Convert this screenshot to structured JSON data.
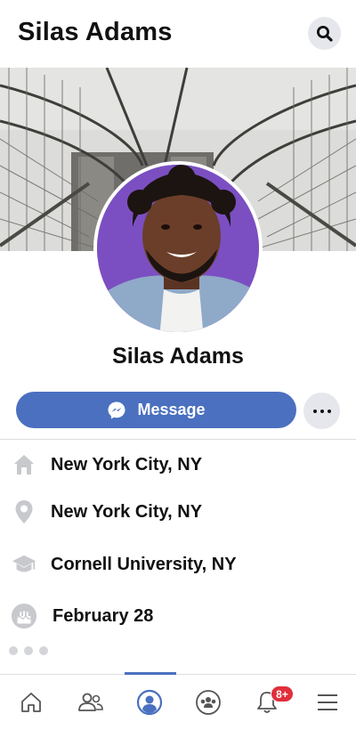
{
  "header": {
    "title": "Silas Adams",
    "search_icon": "search-icon"
  },
  "profile": {
    "name": "Silas Adams",
    "message_label": "Message",
    "message_icon": "messenger-icon",
    "more_icon": "more-horizontal-icon"
  },
  "info": [
    {
      "icon": "home-icon",
      "text": "New York City, NY"
    },
    {
      "icon": "location-pin-icon",
      "text": "New York City, NY"
    },
    {
      "icon": "graduation-cap-icon",
      "text": "Cornell University, NY"
    },
    {
      "icon": "birthday-cake-icon",
      "text": "February 28"
    }
  ],
  "tabbar": {
    "items": [
      "home-icon",
      "friends-icon",
      "profile-icon",
      "groups-icon",
      "notifications-icon",
      "menu-icon"
    ],
    "active": "profile-icon",
    "notification_badge": "8+"
  },
  "colors": {
    "accent": "#4a70bf",
    "badge": "#e12f3b",
    "muted_icon": "#c8c9cc"
  }
}
